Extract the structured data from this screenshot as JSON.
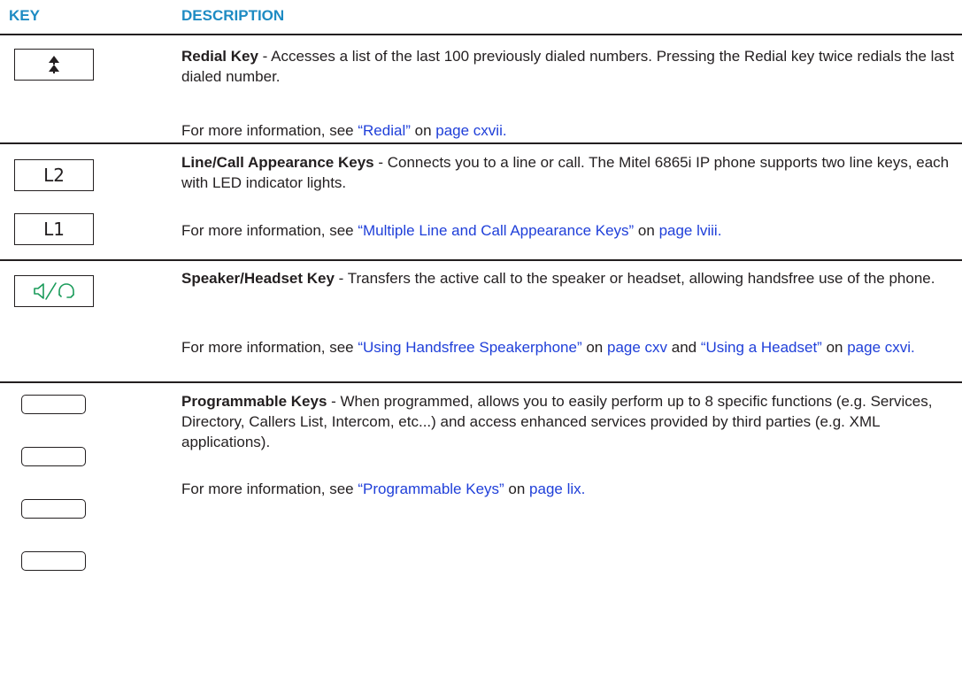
{
  "header": {
    "key": "KEY",
    "description": "DESCRIPTION"
  },
  "rows": [
    {
      "title": "Redial Key",
      "text": " - Accesses a list of the last 100 previously dialed numbers. Pressing the Redial key twice redials the last dialed number.",
      "more_prefix": "For more information, see ",
      "link1": "“Redial”",
      "on1": " on ",
      "page1": "page cxvii."
    },
    {
      "title": "Line/Call Appearance Keys",
      "text": " - Connects you to a line or call. The Mitel 6865i IP phone supports two line keys, each with LED indicator lights.",
      "more_prefix": "For more information, see ",
      "link1": "“Multiple Line and Call Appearance Keys”",
      "on1": " on ",
      "page1": "page lviii.",
      "key_labels": [
        "L2",
        "L1"
      ]
    },
    {
      "title": "Speaker/Headset Key",
      "text": " - Transfers the active call to the speaker or headset, allowing handsfree use of the phone.",
      "more_prefix": "For more information, see ",
      "link1": "“Using Handsfree Speakerphone”",
      "on1": " on ",
      "page1": "page cxv",
      "and": " and ",
      "link2": "“Using a Headset”",
      "on2": " on ",
      "page2": "page cxvi."
    },
    {
      "title": "Programmable Keys",
      "text": " - When programmed, allows you to easily perform up to 8 specific functions (e.g. Services, Directory, Callers List, Intercom, etc...) and access enhanced services provided by third parties (e.g. XML applications).",
      "more_prefix": "For more information, see ",
      "link1": "“Programmable Keys”",
      "on1": " on ",
      "page1": "page lix."
    }
  ],
  "icons": {
    "redial": "redial-up-arrows-icon",
    "speaker": "speaker-headset-icon",
    "icon_color": "#1a9b5a"
  },
  "colors": {
    "header": "#1e8bc3",
    "link": "#1f3fd9",
    "text": "#231f20"
  }
}
